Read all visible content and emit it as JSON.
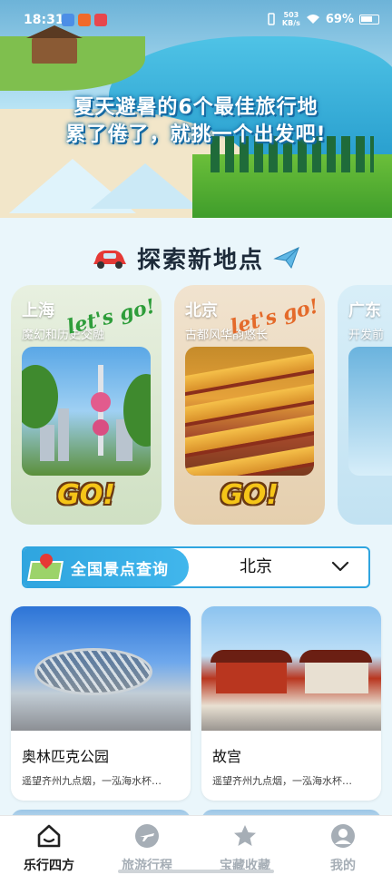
{
  "status_bar": {
    "time": "18:31",
    "net_speed_value": "503",
    "net_speed_unit": "KB/s",
    "battery": "69%"
  },
  "hero": {
    "line1": "夏天避暑的6个最佳旅行地",
    "line2": "累了倦了，就挑一个出发吧!"
  },
  "explore": {
    "title": "探索新地点"
  },
  "destinations": [
    {
      "city": "上海",
      "desc": "魔幻和历史交融",
      "tagline": "let's go!",
      "go": "GO!"
    },
    {
      "city": "北京",
      "desc": "古都风华韵悠长",
      "tagline": "let's go!",
      "go": "GO!"
    },
    {
      "city": "广东",
      "desc": "开发前"
    }
  ],
  "query": {
    "label": "全国景点查询",
    "selected_city": "北京"
  },
  "attractions": [
    {
      "name": "奥林匹克公园",
      "desc": "遥望齐州九点烟，一泓海水杯…"
    },
    {
      "name": "故宫",
      "desc": "遥望齐州九点烟，一泓海水杯…"
    }
  ],
  "nav": {
    "items": [
      {
        "label": "乐行四方",
        "icon": "home-icon",
        "active": true
      },
      {
        "label": "旅游行程",
        "icon": "plane-icon",
        "active": false
      },
      {
        "label": "宝藏收藏",
        "icon": "star-icon",
        "active": false
      },
      {
        "label": "我的",
        "icon": "user-icon",
        "active": false
      }
    ]
  },
  "colors": {
    "accent": "#2fa5df",
    "highlight_box": "#e53935",
    "nav_inactive": "#a6aeb6"
  }
}
